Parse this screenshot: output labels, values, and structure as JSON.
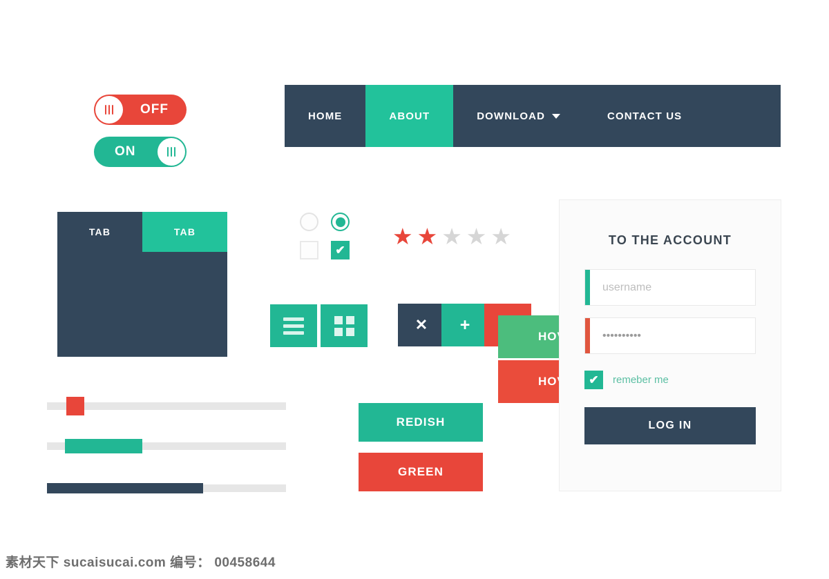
{
  "toggles": [
    {
      "name": "off",
      "label": "OFF",
      "state": "off",
      "color": "#e8463a"
    },
    {
      "name": "on",
      "label": "ON",
      "state": "on",
      "color": "#22b794"
    }
  ],
  "navbar": {
    "background": "#33475b",
    "active_color": "#22c29b",
    "items": [
      {
        "label": "HOME",
        "active": false,
        "has_caret": false
      },
      {
        "label": "ABOUT",
        "active": true,
        "has_caret": false
      },
      {
        "label": "DOWNLOAD",
        "active": false,
        "has_caret": true
      },
      {
        "label": "CONTACT US",
        "active": false,
        "has_caret": false
      }
    ]
  },
  "tab_panel": {
    "tabs": [
      {
        "label": "TAB",
        "active": false
      },
      {
        "label": "TAB",
        "active": true
      }
    ]
  },
  "choices": {
    "radio_unchecked": "",
    "radio_checked": "",
    "checkbox_unchecked": "",
    "checkbox_checked": "✔"
  },
  "rating": {
    "glyph": "★",
    "total": 5,
    "filled": 2,
    "filled_color": "#e8463a",
    "empty_color": "#d6d6d6"
  },
  "icon_buttons": [
    {
      "name": "menu-button",
      "icon": "hamburger-icon",
      "color": "#22b794"
    },
    {
      "name": "grid-button",
      "icon": "grid-icon",
      "color": "#22b794"
    },
    {
      "name": "close-button",
      "icon": "close-icon",
      "glyph": "✕",
      "color": "#33475b"
    },
    {
      "name": "plus-button",
      "icon": "plus-icon",
      "glyph": "+",
      "color": "#22b794"
    },
    {
      "name": "minus-button",
      "icon": "minus-icon",
      "glyph": "−",
      "color": "#e8463a"
    }
  ],
  "hover_buttons": [
    {
      "label": "HOVER",
      "color": "#4cbd7d"
    },
    {
      "label": "HOVER",
      "color": "#ea4c3b"
    }
  ],
  "sliders": [
    {
      "name": "slider-red",
      "handle_color": "#e8463a",
      "value": 8
    },
    {
      "name": "slider-teal",
      "fill_color": "#22b794",
      "value": 32
    },
    {
      "name": "progress-navy",
      "fill_color": "#33475b",
      "value": 65
    }
  ],
  "color_buttons": [
    {
      "label": "REDISH",
      "color": "#22b794"
    },
    {
      "label": "GREEN",
      "color": "#e8463a"
    }
  ],
  "login_card": {
    "title": "TO THE ACCOUNT",
    "username": {
      "placeholder": "username",
      "value": "",
      "accent": "#22b794"
    },
    "password": {
      "placeholder": "",
      "value": "••••••••••",
      "accent": "#e0563f"
    },
    "remember": {
      "label": "remeber me",
      "checked": true,
      "mark": "✔"
    },
    "login_button": "LOG IN"
  },
  "watermark": "素材天下 sucaisucai.com  编号： 00458644"
}
